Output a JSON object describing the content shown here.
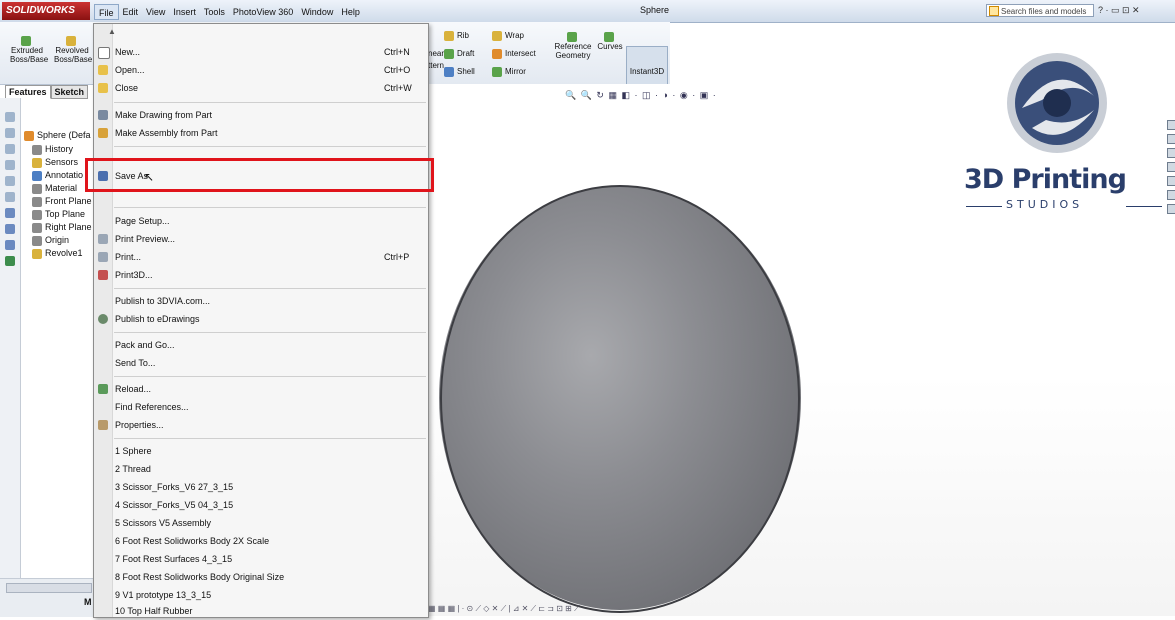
{
  "app": {
    "logo_text": "SOLIDWORKS",
    "document_title": "Sphere",
    "menubar": [
      "File",
      "Edit",
      "View",
      "Insert",
      "Tools",
      "PhotoView 360",
      "Window",
      "Help"
    ],
    "search_placeholder": "Search files and models",
    "window_controls": "? · ▭ ⊡ ✕"
  },
  "command_manager": {
    "extruded": "Extruded\nBoss/Base",
    "revolved": "Revolved\nBoss/Base",
    "linear_pattern": "near\nttern",
    "rib": "Rib",
    "draft": "Draft",
    "shell": "Shell",
    "wrap": "Wrap",
    "intersect": "Intersect",
    "mirror": "Mirror",
    "reference_geometry": "Reference\nGeometry",
    "curves": "Curves",
    "instant3d": "Instant3D"
  },
  "panel_tabs": [
    "Features",
    "Sketch"
  ],
  "tree": [
    "Sphere  (Defa",
    "History",
    "Sensors",
    "Annotatio",
    "Material",
    "Front Plane",
    "Top Plane",
    "Right Plane",
    "Origin",
    "Revolve1"
  ],
  "bottom_tab": "M",
  "file_menu": {
    "items": [
      {
        "label": "New...",
        "shortcut": "Ctrl+N"
      },
      {
        "label": "Open...",
        "shortcut": "Ctrl+O"
      },
      {
        "label": "Close",
        "shortcut": "Ctrl+W"
      },
      {
        "label": "Make Drawing from Part",
        "shortcut": ""
      },
      {
        "label": "Make Assembly from Part",
        "shortcut": ""
      },
      {
        "label": "Save As",
        "shortcut": ""
      },
      {
        "label": "Page Setup...",
        "shortcut": ""
      },
      {
        "label": "Print Preview...",
        "shortcut": ""
      },
      {
        "label": "Print...",
        "shortcut": "Ctrl+P"
      },
      {
        "label": "Print3D...",
        "shortcut": ""
      },
      {
        "label": "Publish to 3DVIA.com...",
        "shortcut": ""
      },
      {
        "label": "Publish to eDrawings",
        "shortcut": ""
      },
      {
        "label": "Pack and Go...",
        "shortcut": ""
      },
      {
        "label": "Send To...",
        "shortcut": ""
      },
      {
        "label": "Reload...",
        "shortcut": ""
      },
      {
        "label": "Find References...",
        "shortcut": ""
      },
      {
        "label": "Properties...",
        "shortcut": ""
      },
      {
        "label": "1 Sphere",
        "shortcut": ""
      },
      {
        "label": "2 Thread",
        "shortcut": ""
      },
      {
        "label": "3 Scissor_Forks_V6 27_3_15",
        "shortcut": ""
      },
      {
        "label": "4 Scissor_Forks_V5 04_3_15",
        "shortcut": ""
      },
      {
        "label": "5 Scissors V5 Assembly",
        "shortcut": ""
      },
      {
        "label": "6 Foot Rest Solidworks Body 2X Scale",
        "shortcut": ""
      },
      {
        "label": "7 Foot Rest Surfaces 4_3_15",
        "shortcut": ""
      },
      {
        "label": "8 Foot Rest Solidworks Body Original Size",
        "shortcut": ""
      },
      {
        "label": "9 V1 prototype 13_3_15",
        "shortcut": ""
      },
      {
        "label": "10 Top Half Rubber",
        "shortcut": ""
      }
    ]
  },
  "brand": {
    "title": "3D Printing",
    "subtitle": "STUDIOS"
  },
  "colors": {
    "highlight_box": "#e0141b",
    "brand_blue": "#2a3e6b",
    "sphere_mid": "#8c8d92"
  }
}
